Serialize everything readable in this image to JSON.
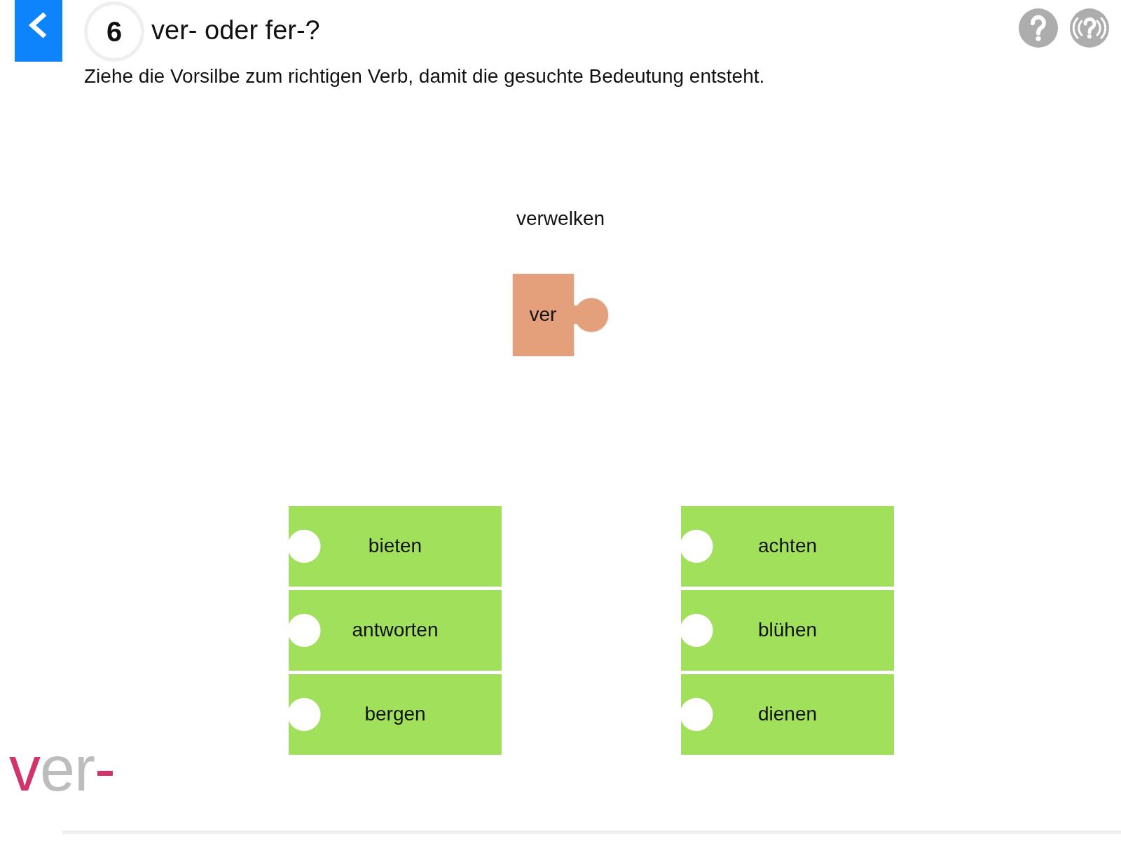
{
  "header": {
    "task_number": "6",
    "title": "ver- oder fer-?",
    "instruction": "Ziehe die Vorsilbe zum richtigen Verb, damit die gesuchte Bedeutung entsteht."
  },
  "target_word": "verwelken",
  "prefix_piece": {
    "label": "ver"
  },
  "word_columns": [
    {
      "pieces": [
        "bieten",
        "antworten",
        "bergen"
      ]
    },
    {
      "pieces": [
        "achten",
        "blühen",
        "dienen"
      ]
    }
  ],
  "logo": {
    "text": "ver-"
  }
}
